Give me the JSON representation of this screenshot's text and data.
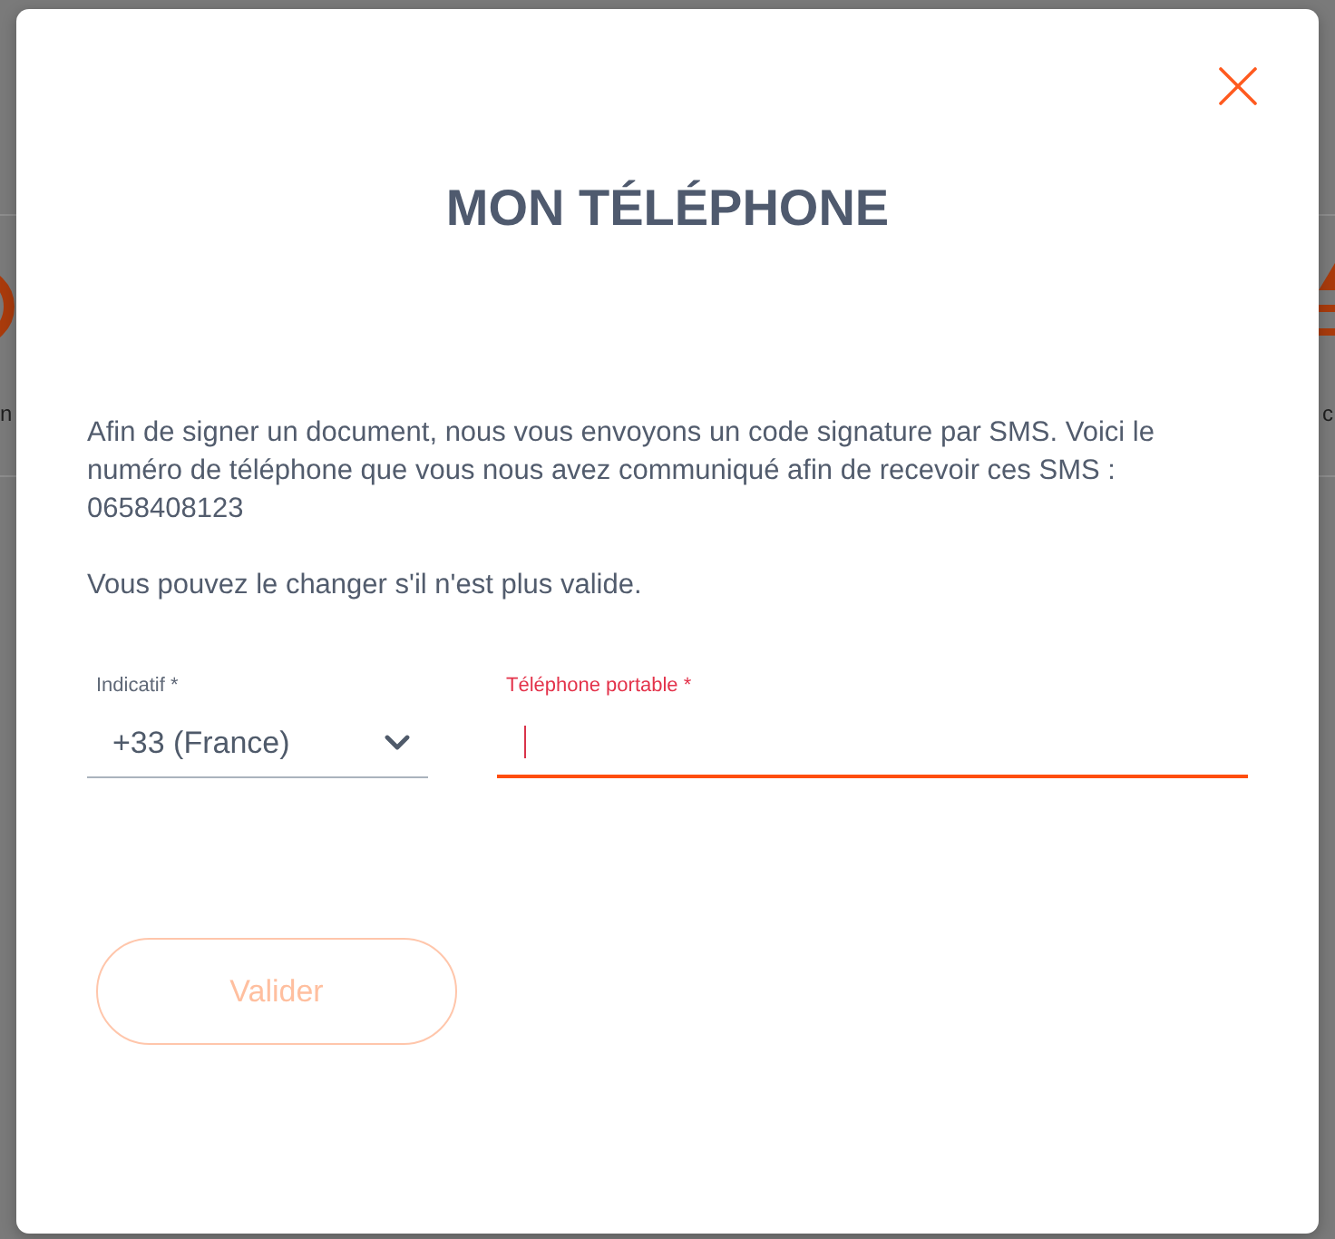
{
  "background": {
    "left_label": "n",
    "right_label": "c"
  },
  "dialog": {
    "title": "MON TÉLÉPHONE",
    "intro": "Afin de signer un document, nous vous envoyons un code signature par SMS. Voici le numéro de téléphone que vous nous avez communiqué afin de recevoir ces SMS :",
    "phone_number": "0658408123",
    "note": "Vous pouvez le changer s'il n'est plus valide."
  },
  "fields": [
    {
      "kind": "select",
      "label": "Indicatif *",
      "value": "+33 (France)",
      "focused": false
    },
    {
      "kind": "text",
      "label": "Téléphone portable *",
      "focused": true
    }
  ],
  "submit": {
    "label": "Valider",
    "disabled": true
  }
}
